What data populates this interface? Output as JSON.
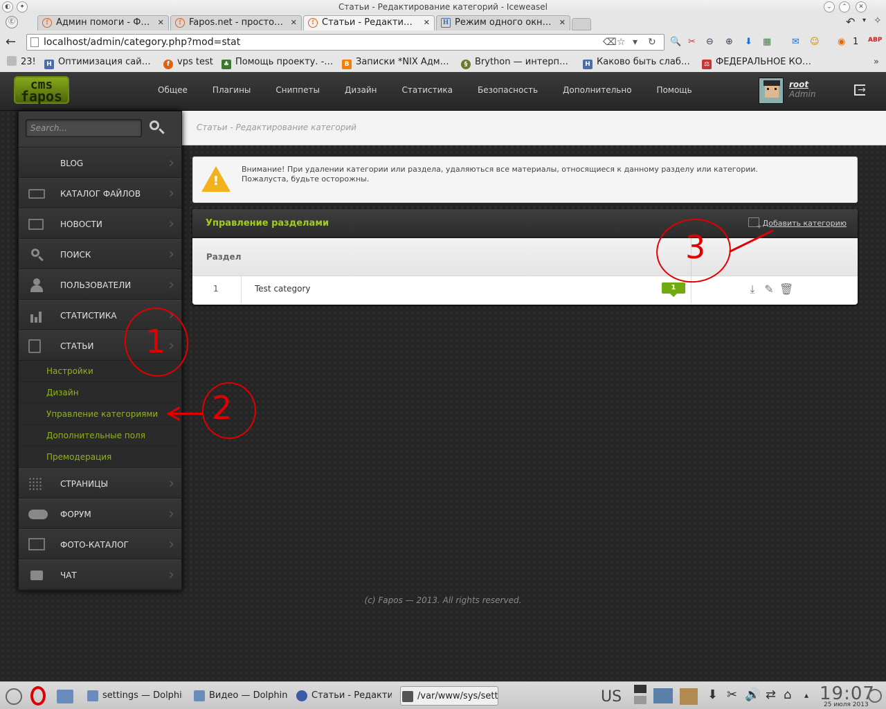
{
  "window": {
    "title": "Статьи - Редактирование категорий - Iceweasel"
  },
  "tabs": [
    {
      "label": "Админ помоги - Ф…",
      "icon": "fapos-icon"
    },
    {
      "label": "Fapos.net - просто…",
      "icon": "fapos-icon"
    },
    {
      "label": "Статьи - Редакти…",
      "icon": "fapos-icon",
      "active": true
    },
    {
      "label": "Режим одного окн…",
      "icon": "habr-icon"
    }
  ],
  "address": {
    "url": "localhost/admin/category.php?mod=stat"
  },
  "toolbar": {
    "counter": "1"
  },
  "bookmarks": [
    {
      "label": "23!",
      "icon": "page-icon",
      "color": "#bbbbbb"
    },
    {
      "label": "Оптимизация сай…",
      "icon": "habr-icon",
      "color": "#4a6ea8"
    },
    {
      "label": "vps test",
      "icon": "fapos-icon",
      "color": "#e06010"
    },
    {
      "label": "Помощь проекту. -…",
      "icon": "tree-icon",
      "color": "#3a7a2a"
    },
    {
      "label": "Записки *NIX Адм…",
      "icon": "blogger-icon",
      "color": "#f57d00"
    },
    {
      "label": "Brython — интерп…",
      "icon": "snake-icon",
      "color": "#6a7a2a"
    },
    {
      "label": "Каково быть слаб…",
      "icon": "habr-icon",
      "color": "#4a6ea8"
    },
    {
      "label": "ФЕДЕРАЛЬНОЕ КО…",
      "icon": "law-icon",
      "color": "#cc3333"
    }
  ],
  "site": {
    "logo": {
      "line1": "cms",
      "line2": "fapos"
    },
    "nav": [
      "Общее",
      "Плагины",
      "Сниппеты",
      "Дизайн",
      "Статистика",
      "Безопасность",
      "Дополнительно",
      "Помощь"
    ],
    "user": {
      "name": "root",
      "role": "Admin"
    },
    "breadcrumb": "Статьи - Редактирование категорий",
    "search_placeholder": "Search...",
    "sidebar": [
      {
        "label": "BLOG",
        "icon": ""
      },
      {
        "label": "КАТАЛОГ ФАЙЛОВ",
        "icon": "folder-icon"
      },
      {
        "label": "НОВОСТИ",
        "icon": "newspaper-icon"
      },
      {
        "label": "ПОИСК",
        "icon": "search-icon"
      },
      {
        "label": "ПОЛЬЗОВАТЕЛИ",
        "icon": "user-icon"
      },
      {
        "label": "СТАТИСТИКА",
        "icon": "bar-chart-icon"
      },
      {
        "label": "СТАТЬИ",
        "icon": "pages-icon"
      },
      {
        "label": "СТРАНИЦЫ",
        "icon": "grid-icon"
      },
      {
        "label": "ФОРУМ",
        "icon": "cloud-icon"
      },
      {
        "label": "ФОТО-КАТАЛОГ",
        "icon": "photo-icon"
      },
      {
        "label": "ЧАТ",
        "icon": "chat-icon"
      }
    ],
    "submenu": [
      "Настройки",
      "Дизайн",
      "Управление категориями",
      "Дополнительные поля",
      "Премодерация"
    ],
    "alert": {
      "line1": "Внимание! При удалении категории или раздела, удаляються все материалы, относящиеся к данному разделу или категории.",
      "line2": "Пожалуста, будьте осторожны."
    },
    "panel": {
      "title": "Управление разделами",
      "add_label": "Добавить категорию",
      "column": "Раздел",
      "rows": [
        {
          "id": "1",
          "name": "Test category",
          "count": "1"
        }
      ]
    },
    "footer": "(c) Fapos — 2013. All rights reserved."
  },
  "annotations": [
    "1",
    "2",
    "3"
  ],
  "taskbar": {
    "tasks": [
      "settings — Dolphin",
      "Видео — Dolphin",
      "Статьи - Редактир",
      "/var/www/sys/sett"
    ],
    "keyboard": "US",
    "time": "19:07",
    "date": "25 июля 2013"
  }
}
